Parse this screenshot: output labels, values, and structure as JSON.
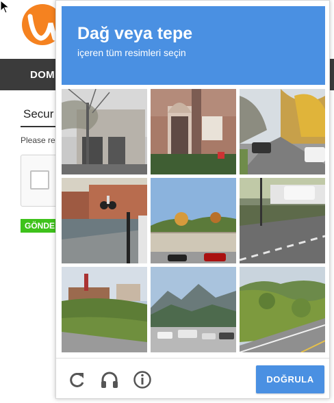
{
  "background_page": {
    "nav_item": "DOM",
    "security_title": "Secur",
    "please_text": "Please re",
    "submit_label": "GÖNDE"
  },
  "challenge": {
    "title": "Dağ veya tepe",
    "subtitle": "içeren tüm resimleri seçin",
    "tiles": [
      {
        "scene": "street-building-tree"
      },
      {
        "scene": "red-brick-house-door"
      },
      {
        "scene": "suburban-street-cars"
      },
      {
        "scene": "cyclist-sidewalk-wall"
      },
      {
        "scene": "hill-fence-cars"
      },
      {
        "scene": "empty-road-curb"
      },
      {
        "scene": "hillside-buildings-grass"
      },
      {
        "scene": "mountains-parking-lot"
      },
      {
        "scene": "grassy-hill-road"
      }
    ],
    "footer": {
      "reload_icon": "reload-icon",
      "audio_icon": "headphones-icon",
      "info_icon": "info-icon",
      "verify_label": "DOĞRULA"
    },
    "colors": {
      "accent": "#4a90e2"
    }
  }
}
